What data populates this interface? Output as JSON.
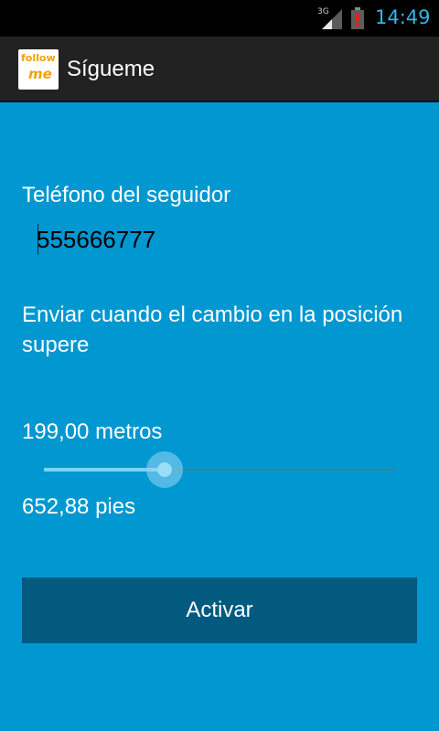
{
  "status_bar": {
    "network": "3G",
    "time": "14:49",
    "battery_level": 0.15
  },
  "action_bar": {
    "logo_line1": "follow",
    "logo_line2": "me",
    "title": "Sígueme"
  },
  "form": {
    "phone_label": "Teléfono del seguidor",
    "phone_value": "555666777",
    "change_label": "Enviar cuando el cambio en la posición supere",
    "meters": "199,00 metros",
    "feet": "652,88 pies",
    "slider_fraction": 0.345,
    "activate_label": "Activar"
  },
  "colors": {
    "background": "#0197d1",
    "action_bar": "#222222",
    "button": "#025a7e",
    "clock": "#33b5e5",
    "logo_orange": "#f3a10d"
  }
}
